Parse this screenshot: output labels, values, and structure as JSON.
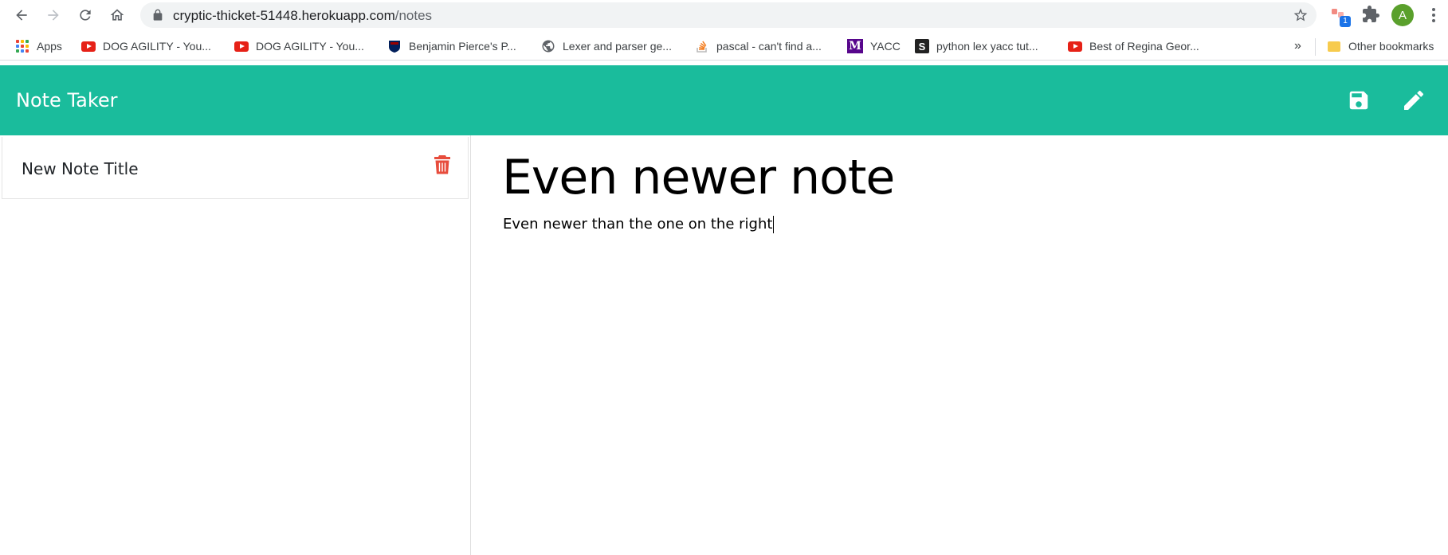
{
  "browser": {
    "url_host": "cryptic-thicket-51448.herokuapp.com",
    "url_path": "/notes",
    "extension_badge": "1",
    "profile_initial": "A"
  },
  "bookmarks": {
    "items": [
      {
        "label": "Apps",
        "icon": "apps-grid-icon"
      },
      {
        "label": "DOG AGILITY - You...",
        "icon": "youtube-icon"
      },
      {
        "label": "DOG AGILITY - You...",
        "icon": "youtube-icon"
      },
      {
        "label": "Benjamin Pierce's P...",
        "icon": "penn-shield-icon"
      },
      {
        "label": "Lexer and parser ge...",
        "icon": "globe-icon"
      },
      {
        "label": "pascal - can't find a...",
        "icon": "stackoverflow-icon"
      },
      {
        "label": "YACC",
        "icon": "m-logo-icon"
      },
      {
        "label": "python lex yacc tut...",
        "icon": "s-logo-icon"
      },
      {
        "label": "Best of Regina Geor...",
        "icon": "youtube-icon"
      }
    ],
    "overflow": "»",
    "other_bookmarks": "Other bookmarks"
  },
  "app": {
    "title": "Note Taker",
    "accent_color": "#1abc9c"
  },
  "notes_list": [
    {
      "title": "New Note Title"
    }
  ],
  "editor": {
    "title": "Even newer note",
    "text": "Even newer than the one on the right"
  }
}
